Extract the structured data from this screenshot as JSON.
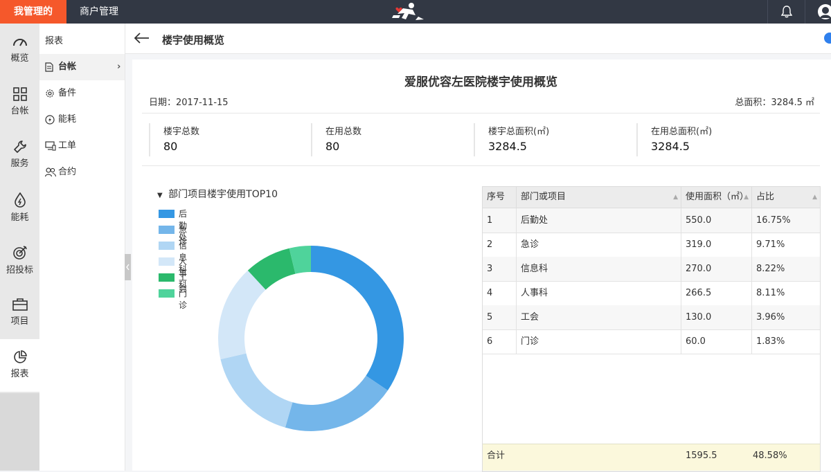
{
  "topbar": {
    "tab_my": "我管理的",
    "tab_merchant": "商户管理",
    "logo_icon": "runner-logo-icon",
    "bell_icon": "bell-icon",
    "avatar_icon": "avatar-icon",
    "accent": "#f5582b",
    "bg": "#323844"
  },
  "leftnav": {
    "items": [
      {
        "label": "概览",
        "icon": "gauge-icon"
      },
      {
        "label": "台帐",
        "icon": "grid-icon"
      },
      {
        "label": "服务",
        "icon": "wrench-icon"
      },
      {
        "label": "能耗",
        "icon": "drop-icon"
      },
      {
        "label": "招投标",
        "icon": "target-icon"
      },
      {
        "label": "项目",
        "icon": "briefcase-icon"
      },
      {
        "label": "报表",
        "icon": "pie-icon"
      }
    ],
    "active_index": 6
  },
  "subnav": {
    "title": "报表",
    "items": [
      {
        "label": "台帐",
        "icon": "document-icon"
      },
      {
        "label": "备件",
        "icon": "gear-icon"
      },
      {
        "label": "能耗",
        "icon": "bolt-icon"
      },
      {
        "label": "工单",
        "icon": "monitor-icon"
      },
      {
        "label": "合约",
        "icon": "users-icon"
      }
    ],
    "active_index": 0
  },
  "page": {
    "title": "楼宇使用概览",
    "back_icon": "arrow-left-icon",
    "info_icon": "info-icon"
  },
  "report": {
    "title": "爱服优容左医院楼宇使用概览",
    "date": "日期：2017-11-15",
    "total_area": "总面积：3284.5 ㎡",
    "stats": [
      {
        "label": "楼宇总数",
        "value": "80"
      },
      {
        "label": "在用总数",
        "value": "80"
      },
      {
        "label": "楼宇总面积(㎡)",
        "value": "3284.5"
      },
      {
        "label": "在用总面积(㎡)",
        "value": "3284.5"
      }
    ]
  },
  "chart_data": {
    "type": "pie",
    "title": "部门项目楼宇使用TOP10",
    "donut": true,
    "legend_position": "left",
    "categories": [
      "后勤处",
      "急诊",
      "信息科",
      "人事科",
      "工会",
      "门诊"
    ],
    "values": [
      550.0,
      319.0,
      270.0,
      266.5,
      130.0,
      60.0
    ],
    "colors": [
      "#3497e3",
      "#74b6ea",
      "#b0d6f4",
      "#d3e7f8",
      "#2bb96c",
      "#4fd39b"
    ]
  },
  "table": {
    "headers": [
      "序号",
      "部门或项目",
      "使用面积（㎡）",
      "占比"
    ],
    "rows": [
      [
        "1",
        "后勤处",
        "550.0",
        "16.75%"
      ],
      [
        "2",
        "急诊",
        "319.0",
        "9.71%"
      ],
      [
        "3",
        "信息科",
        "270.0",
        "8.22%"
      ],
      [
        "4",
        "人事科",
        "266.5",
        "8.11%"
      ],
      [
        "5",
        "工会",
        "130.0",
        "3.96%"
      ],
      [
        "6",
        "门诊",
        "60.0",
        "1.83%"
      ]
    ],
    "footer": {
      "label": "合计",
      "area": "1595.5",
      "ratio": "48.58%"
    }
  }
}
